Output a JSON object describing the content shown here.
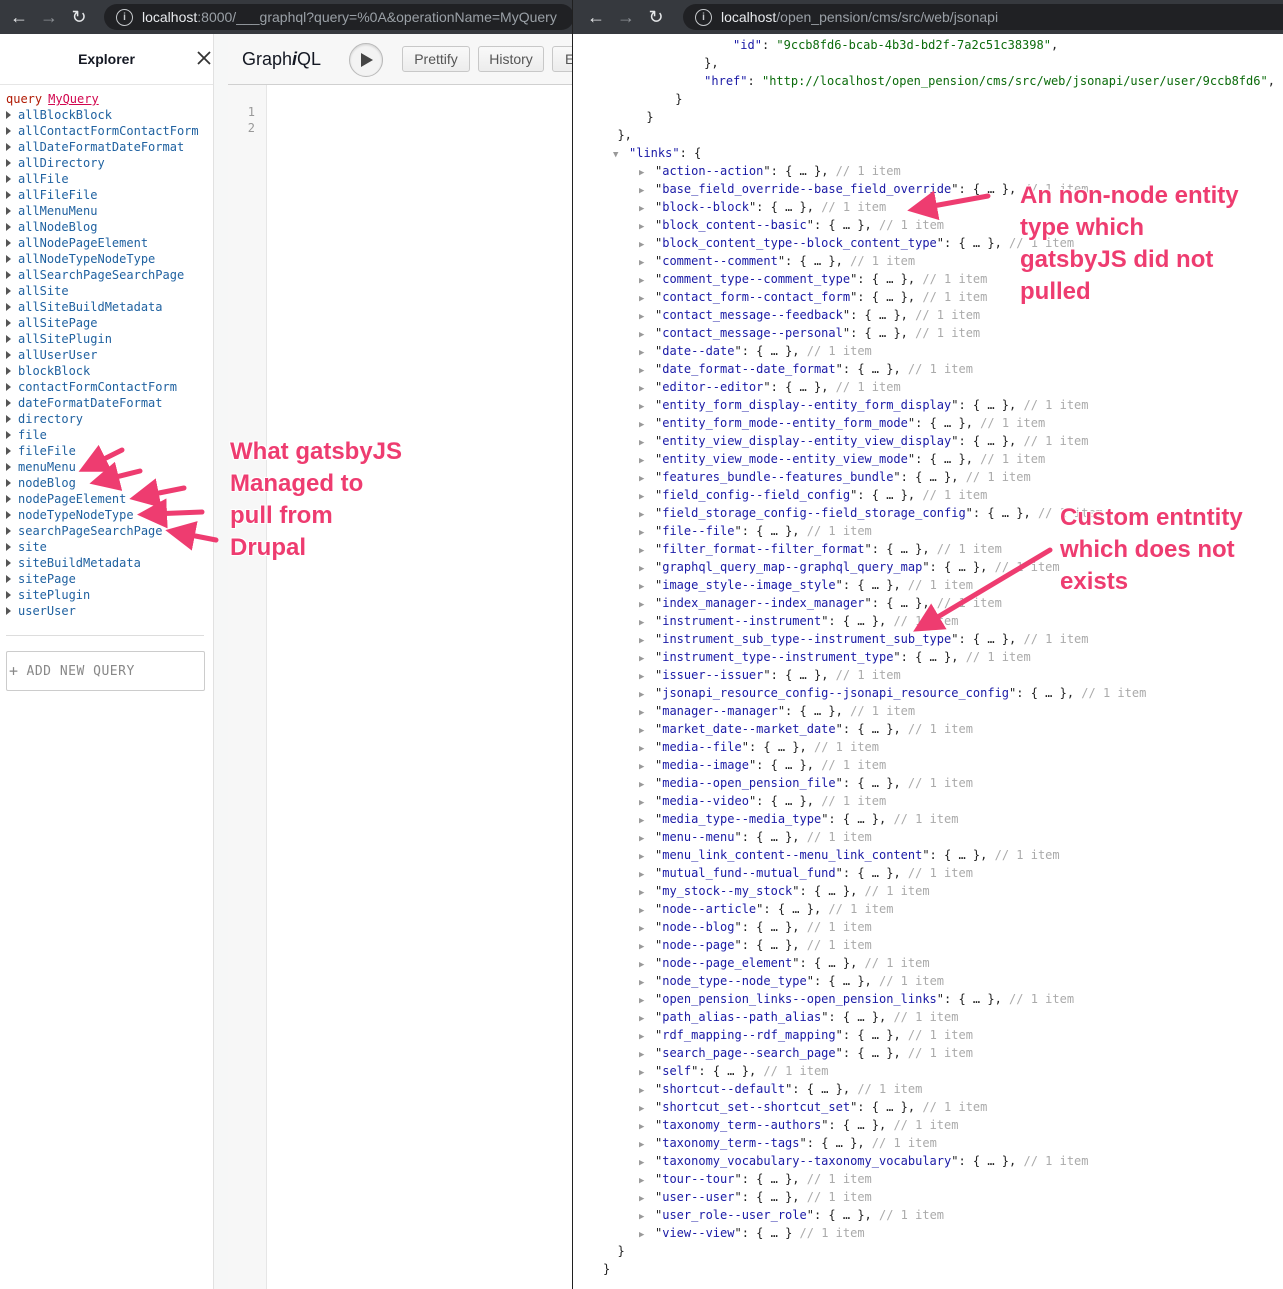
{
  "left_browser": {
    "url_host": "localhost",
    "url_rest": ":8000/___graphql?query=%0A&operationName=MyQuery"
  },
  "explorer": {
    "title": "Explorer",
    "query_keyword": "query",
    "query_name": "MyQuery",
    "items": [
      "allBlockBlock",
      "allContactFormContactForm",
      "allDateFormatDateFormat",
      "allDirectory",
      "allFile",
      "allFileFile",
      "allMenuMenu",
      "allNodeBlog",
      "allNodePageElement",
      "allNodeTypeNodeType",
      "allSearchPageSearchPage",
      "allSite",
      "allSiteBuildMetadata",
      "allSitePage",
      "allSitePlugin",
      "allUserUser",
      "blockBlock",
      "contactFormContactForm",
      "dateFormatDateFormat",
      "directory",
      "file",
      "fileFile",
      "menuMenu",
      "nodeBlog",
      "nodePageElement",
      "nodeTypeNodeType",
      "searchPageSearchPage",
      "site",
      "siteBuildMetadata",
      "sitePage",
      "sitePlugin",
      "userUser"
    ],
    "add_query_plus": "+",
    "add_query_label": "ADD NEW QUERY"
  },
  "graphiql": {
    "logo": "GraphiQL",
    "buttons": [
      "Prettify",
      "History",
      "E"
    ],
    "line_numbers": [
      "1",
      "2"
    ]
  },
  "right_browser": {
    "url_host": "localhost",
    "url_rest": "/open_pension/cms/src/web/jsonapi"
  },
  "json": {
    "top_lines": [
      {
        "indent": "                  ",
        "key": "\"id\"",
        "value": "\"9ccb8fd6-bcab-4b3d-bd2f-7a2c51c38398\""
      },
      {
        "indent": "              ",
        "punct": "},"
      },
      {
        "indent": "              ",
        "key": "\"href\"",
        "value": "\"http://localhost/open_pension/cms/src/web/jsonapi/user/user/9ccb8fd6\""
      },
      {
        "indent": "          ",
        "punct": "}"
      },
      {
        "indent": "      ",
        "punct": "}"
      },
      {
        "indent": "  ",
        "punct": "},"
      }
    ],
    "links_key": "\"links\"",
    "collapsed_value": "{ … }",
    "item_comment": "// 1 item",
    "link_keys": [
      "action--action",
      "base_field_override--base_field_override",
      "block--block",
      "block_content--basic",
      "block_content_type--block_content_type",
      "comment--comment",
      "comment_type--comment_type",
      "contact_form--contact_form",
      "contact_message--feedback",
      "contact_message--personal",
      "date--date",
      "date_format--date_format",
      "editor--editor",
      "entity_form_display--entity_form_display",
      "entity_form_mode--entity_form_mode",
      "entity_view_display--entity_view_display",
      "entity_view_mode--entity_view_mode",
      "features_bundle--features_bundle",
      "field_config--field_config",
      "field_storage_config--field_storage_config",
      "file--file",
      "filter_format--filter_format",
      "graphql_query_map--graphql_query_map",
      "image_style--image_style",
      "index_manager--index_manager",
      "instrument--instrument",
      "instrument_sub_type--instrument_sub_type",
      "instrument_type--instrument_type",
      "issuer--issuer",
      "jsonapi_resource_config--jsonapi_resource_config",
      "manager--manager",
      "market_date--market_date",
      "media--file",
      "media--image",
      "media--open_pension_file",
      "media--video",
      "media_type--media_type",
      "menu--menu",
      "menu_link_content--menu_link_content",
      "mutual_fund--mutual_fund",
      "my_stock--my_stock",
      "node--article",
      "node--blog",
      "node--page",
      "node--page_element",
      "node_type--node_type",
      "open_pension_links--open_pension_links",
      "path_alias--path_alias",
      "rdf_mapping--rdf_mapping",
      "search_page--search_page",
      "self",
      "shortcut--default",
      "shortcut_set--shortcut_set",
      "taxonomy_term--authors",
      "taxonomy_term--tags",
      "taxonomy_vocabulary--taxonomy_vocabulary",
      "tour--tour",
      "user--user",
      "user_role--user_role",
      "view--view"
    ],
    "closing_lines": [
      "  }",
      "}"
    ]
  },
  "annotations": {
    "gatsby_pulled": [
      "What gatsbyJS",
      "Managed to",
      "pull from",
      "Drupal"
    ],
    "non_node": [
      "An non-node entity",
      "type  which",
      "gatsbyJS did not",
      "pulled"
    ],
    "custom_entity": [
      "Custom entntity",
      "which does not",
      "exists"
    ],
    "color": "#ee3c70"
  }
}
